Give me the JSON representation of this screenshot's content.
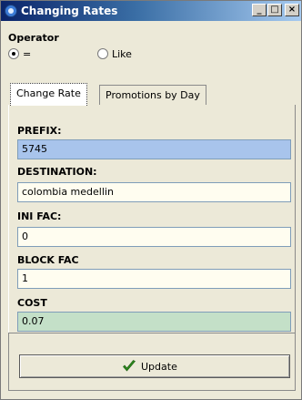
{
  "window": {
    "title": "Changing Rates",
    "buttons": {
      "minimize": "_",
      "maximize": "□",
      "close": "×"
    }
  },
  "operator": {
    "label": "Operator",
    "options": [
      {
        "label": "=",
        "selected": true
      },
      {
        "label": "Like",
        "selected": false
      }
    ]
  },
  "tabs": [
    {
      "label": "Change Rate",
      "active": true
    },
    {
      "label": "Promotions by Day",
      "active": false
    }
  ],
  "fields": {
    "prefix": {
      "label": "PREFIX:",
      "value": "5745"
    },
    "destination": {
      "label": "DESTINATION:",
      "value": "colombia medellin"
    },
    "ini_fac": {
      "label": "INI FAC:",
      "value": "0"
    },
    "block_fac": {
      "label": "BLOCK FAC",
      "value": "1"
    },
    "cost": {
      "label": "COST",
      "value": "0.07"
    }
  },
  "update_button": {
    "label": "Update"
  },
  "colors": {
    "prefix_bg": "#a8c4ec",
    "cost_bg": "#c4e0c8",
    "input_bg": "#fffdf0",
    "titlebar_start": "#0a246a",
    "titlebar_end": "#a6caf0",
    "check_green": "#2e8b1e"
  }
}
